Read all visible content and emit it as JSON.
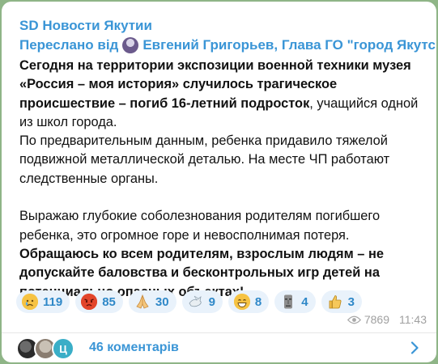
{
  "post": {
    "channel_name": "SD Новости Якутии",
    "forwarded_prefix": "Переслано від",
    "forwarded_from": "Евгений Григорьев, Глава ГО \"город Якутск\".",
    "paragraph1_bold": "Сегодня на территории экспозиции военной техники музея «Россия – моя история» случилось трагическое происшествие – погиб 16-летний подросток",
    "paragraph1_rest": ", учащийся одной из школ города.",
    "paragraph2": "По предварительным данным, ребенка придавило тяжелой подвижной металлической деталью. На месте ЧП работают следственные органы.",
    "paragraph3": "Выражаю глубокие соболезнования родителям погибшего ребенка, это огромное горе и невосполнимая потеря.",
    "paragraph4_bold": "Обращаюсь ко всем родителям, взрослым людям – не допускайте баловства и бесконтрольных игр детей на потенциально опасных объектах!"
  },
  "reactions": [
    {
      "icon": "crying-face-emoji",
      "glyph": "😢",
      "count": "119"
    },
    {
      "icon": "angry-face-emoji",
      "glyph": "😡",
      "count": "85"
    },
    {
      "icon": "praying-hands-emoji",
      "glyph": "🙏",
      "count": "30"
    },
    {
      "icon": "dove-emoji",
      "glyph": "🕊",
      "count": "9"
    },
    {
      "icon": "grinning-face-emoji",
      "glyph": "😁",
      "count": "8"
    },
    {
      "icon": "moai-emoji",
      "glyph": "🗿",
      "count": "4"
    },
    {
      "icon": "thumbs-up-emoji",
      "glyph": "👍",
      "count": "3"
    }
  ],
  "meta": {
    "views": "7869",
    "time": "11:43"
  },
  "comments": {
    "label": "46 коментарів",
    "avatar_letter": "Ц"
  },
  "colors": {
    "background": "#8fb587",
    "accent": "#3a95d6",
    "reaction_bg": "#e9f2fb"
  }
}
